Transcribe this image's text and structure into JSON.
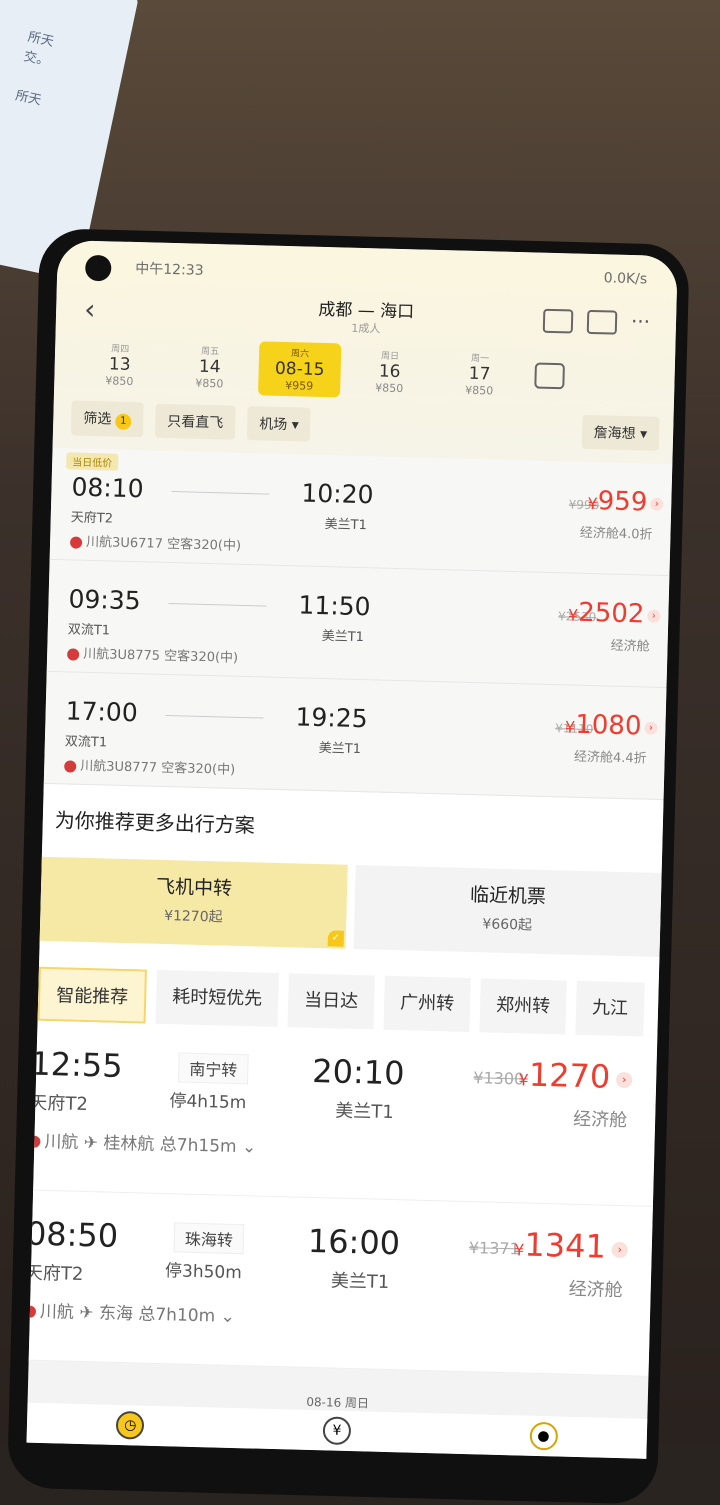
{
  "status_bar": {
    "time": "中午12:33",
    "network": "0.0K/s"
  },
  "header": {
    "route": "成都 — 海口",
    "subtitle": "1成人",
    "icons": [
      "notify-icon",
      "share-icon",
      "more-icon"
    ]
  },
  "dates": [
    {
      "week": "周四",
      "day": "13",
      "price": "¥850"
    },
    {
      "week": "周五",
      "day": "14",
      "price": "¥850"
    },
    {
      "week": "周六",
      "day": "08-15",
      "price": "¥959",
      "selected": true
    },
    {
      "week": "周日",
      "day": "16",
      "price": "¥850"
    },
    {
      "week": "周一",
      "day": "17",
      "price": "¥850"
    }
  ],
  "filters": {
    "filter": "筛选",
    "filter_count": "1",
    "direct_only": "只看直飞",
    "airport": "机场",
    "sort": "詹海想"
  },
  "flights": [
    {
      "tag": "当日低价",
      "dep": "08:10",
      "dep_terminal": "天府T2",
      "arr": "10:20",
      "arr_terminal": "美兰T1",
      "airline": "川航3U6717",
      "aircraft": "空客320(中)",
      "old_price": "¥990",
      "price": "959",
      "cabin": "经济舱4.0折"
    },
    {
      "tag": "",
      "dep": "09:35",
      "dep_terminal": "双流T1",
      "arr": "11:50",
      "arr_terminal": "美兰T1",
      "airline": "川航3U8775",
      "aircraft": "空客320(中)",
      "old_price": "¥2530",
      "price": "2502",
      "cabin": "经济舱"
    },
    {
      "tag": "",
      "dep": "17:00",
      "dep_terminal": "双流T1",
      "arr": "19:25",
      "arr_terminal": "美兰T1",
      "airline": "川航3U8777",
      "aircraft": "空客320(中)",
      "old_price": "¥1110",
      "price": "1080",
      "cabin": "经济舱4.4折"
    }
  ],
  "recommend": {
    "title": "为你推荐更多出行方案",
    "options": [
      {
        "label": "飞机中转",
        "price": "¥1270起"
      },
      {
        "label": "临近机票",
        "price": "¥660起"
      }
    ],
    "tabs": [
      "智能推荐",
      "耗时短优先",
      "当日达",
      "广州转",
      "郑州转",
      "九江"
    ]
  },
  "transfers": [
    {
      "dep": "12:55",
      "dep_terminal": "天府T2",
      "via": "南宁转",
      "stop": "停4h15m",
      "arr": "20:10",
      "arr_terminal": "美兰T1",
      "airline1": "川航",
      "airline2": "桂林航",
      "total": "总7h15m",
      "old_price": "¥1300",
      "price": "1270",
      "cabin": "经济舱"
    },
    {
      "dep": "08:50",
      "dep_terminal": "天府T2",
      "via": "珠海转",
      "stop": "停3h50m",
      "arr": "16:00",
      "arr_terminal": "美兰T1",
      "airline1": "川航",
      "airline2": "东海",
      "total": "总7h10m",
      "old_price": "¥1371",
      "price": "1341",
      "cabin": "经济舱"
    }
  ],
  "footer": {
    "date_hint": "08-16 周日"
  }
}
